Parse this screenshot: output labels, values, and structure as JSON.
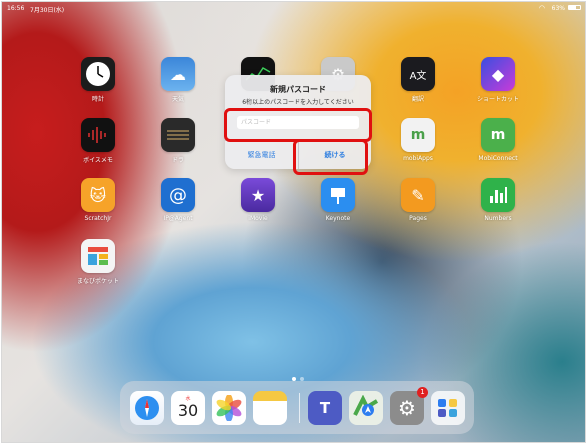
{
  "status": {
    "time": "16:56",
    "date": "7月30日(水)",
    "battery": "63%"
  },
  "apps": [
    {
      "label": "時計",
      "icon": "clock-icon"
    },
    {
      "label": "天気",
      "icon": "weather-icon"
    },
    {
      "label": "",
      "icon": "stocks-icon"
    },
    {
      "label": "",
      "icon": "settings-icon"
    },
    {
      "label": "翻訳",
      "icon": "translate-icon"
    },
    {
      "label": "ショートカット",
      "icon": "shortcuts-icon"
    },
    {
      "label": "ボイスメモ",
      "icon": "voice-memo-icon"
    },
    {
      "label": "ドラ",
      "icon": "drum-icon"
    },
    {
      "label": "mobiApps",
      "icon": "mobiapps-icon"
    },
    {
      "label": "MobiConnect",
      "icon": "mobiconnect-icon"
    },
    {
      "label": "ScratchJr",
      "icon": "scratchjr-icon"
    },
    {
      "label": "IP@Agent",
      "icon": "ipagent-icon"
    },
    {
      "label": "iMovie",
      "icon": "imovie-icon"
    },
    {
      "label": "Keynote",
      "icon": "keynote-icon"
    },
    {
      "label": "Pages",
      "icon": "pages-icon"
    },
    {
      "label": "Numbers",
      "icon": "numbers-icon"
    },
    {
      "label": "まなびポケット",
      "icon": "manabi-pocket-icon"
    }
  ],
  "dialog": {
    "title": "新規パスコード",
    "message": "6桁以上のパスコードを入力してください",
    "placeholder": "パスコード",
    "emergency_label": "緊急電話",
    "continue_label": "続ける"
  },
  "dock": {
    "calendar_day": "水",
    "calendar_date": "30",
    "settings_badge": "1",
    "apps": [
      "safari-icon",
      "calendar-icon",
      "photos-icon",
      "notes-icon",
      "teams-icon",
      "maps-icon",
      "settings-icon",
      "folder-icon"
    ]
  },
  "colors": {
    "highlight": "#e01010",
    "link": "#2f7fe0"
  }
}
